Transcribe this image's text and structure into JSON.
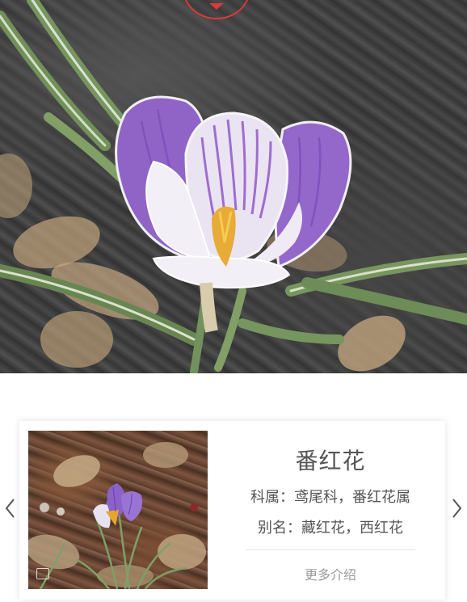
{
  "hero": {
    "image": "crocus-flower-photo",
    "badge_icon": "chevron-down-icon",
    "badge_color": "#d93a3a"
  },
  "card": {
    "thumbnail": "crocus-thumbnail-photo",
    "name": "番红花",
    "family": "科属：鸢尾科，番红花属",
    "alias": "别名：藏红花，西红花",
    "more_label": "更多介绍"
  },
  "nav": {
    "prev_icon": "chevron-left-icon",
    "next_icon": "chevron-right-icon"
  },
  "colors": {
    "text": "#555555",
    "muted": "#9a9a9a",
    "petal": "#8a5bc4",
    "stamen": "#e6a62a",
    "leaf": "#6f8f55"
  }
}
